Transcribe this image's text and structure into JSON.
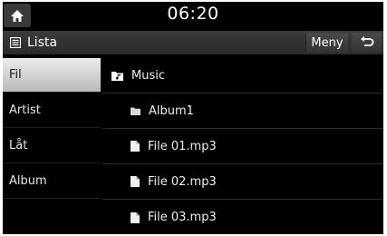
{
  "status_bar": {
    "time": "06:20"
  },
  "header": {
    "title": "Lista",
    "menu_label": "Meny",
    "title_icon": "list-icon",
    "back_icon": "back-arrow-icon"
  },
  "sidebar": {
    "items": [
      {
        "label": "Fil",
        "selected": true
      },
      {
        "label": "Artist",
        "selected": false
      },
      {
        "label": "Låt",
        "selected": false
      },
      {
        "label": "Album",
        "selected": false
      }
    ]
  },
  "file_list": {
    "items": [
      {
        "label": "Music",
        "icon": "music-folder-icon"
      },
      {
        "label": "Album1",
        "icon": "folder-icon"
      },
      {
        "label": "File 01.mp3",
        "icon": "file-icon"
      },
      {
        "label": "File 02.mp3",
        "icon": "file-icon"
      },
      {
        "label": "File 03.mp3",
        "icon": "file-icon"
      }
    ]
  }
}
